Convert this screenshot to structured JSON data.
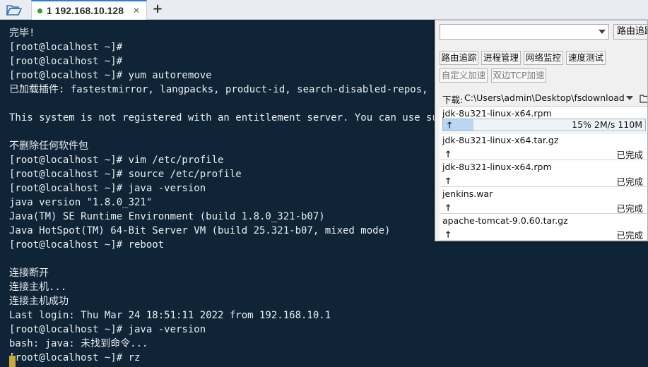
{
  "tabbar": {
    "tab_label": "1 192.168.10.128",
    "close_glyph": "✕",
    "add_glyph": "+"
  },
  "terminal": {
    "lines": [
      "完毕!",
      "[root@localhost ~]#",
      "[root@localhost ~]#",
      "[root@localhost ~]# yum autoremove",
      "已加载插件: fastestmirror, langpacks, product-id, search-disabled-repos, sub",
      "",
      "This system is not registered with an entitlement server. You can use subscr",
      "",
      "不删除任何软件包",
      "[root@localhost ~]# vim /etc/profile",
      "[root@localhost ~]# source /etc/profile",
      "[root@localhost ~]# java -version",
      "java version \"1.8.0_321\"",
      "Java(TM) SE Runtime Environment (build 1.8.0_321-b07)",
      "Java HotSpot(TM) 64-Bit Server VM (build 25.321-b07, mixed mode)",
      "[root@localhost ~]# reboot",
      "",
      "连接断开",
      "连接主机...",
      "连接主机成功",
      "Last login: Thu Mar 24 18:51:11 2022 from 192.168.10.1",
      "[root@localhost ~]# java -version",
      "bash: java: 未找到命令...",
      "[root@localhost ~]# rz"
    ]
  },
  "panel": {
    "route_select_value": "",
    "route_button": "路由追踪",
    "tools": {
      "route_trace": "路由追踪",
      "process_manager": "进程管理",
      "network_monitor": "网络监控",
      "speed_test": "速度测试",
      "custom_accel": "自定义加速",
      "dual_tcp_accel": "双边TCP加速"
    },
    "download_label": "下载:",
    "download_path": "C:\\Users\\admin\\Desktop\\fsdownload",
    "transfers": [
      {
        "name": "jdk-8u321-linux-x64.rpm",
        "status": "15% 2M/s 110M",
        "progress": 0.15,
        "active": true
      },
      {
        "name": "jdk-8u321-linux-x64.tar.gz",
        "status": "已完成",
        "active": false
      },
      {
        "name": "jdk-8u321-linux-x64.rpm",
        "status": "已完成",
        "active": false
      },
      {
        "name": "jenkins.war",
        "status": "已完成",
        "active": false
      },
      {
        "name": "apache-tomcat-9.0.60.tar.gz",
        "status": "已完成",
        "active": false
      }
    ],
    "upload_arrow_glyph": "🡑"
  },
  "colors": {
    "terminal_bg": "#0f2537",
    "terminal_fg": "#e8ecef",
    "cursor": "#c8a93a",
    "tab_accent": "#2f7fd1",
    "connected_dot": "#2aa52a",
    "progress_fill": "#b9d7f2"
  },
  "icons": {
    "open_folder": "folder-open-icon",
    "download_folder": "folder-icon",
    "upload": "arrow-up-icon"
  }
}
